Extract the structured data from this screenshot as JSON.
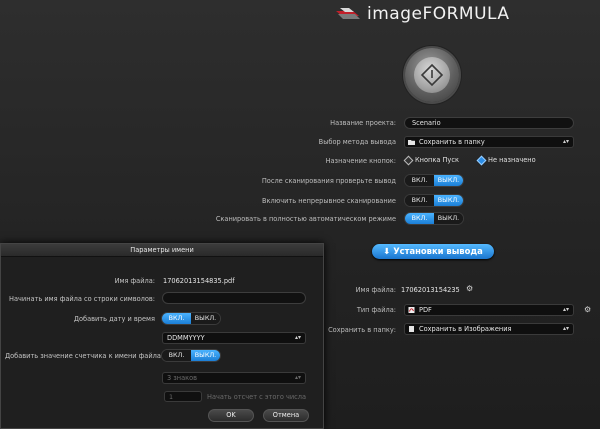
{
  "app": {
    "logo_text": "imageFORMULA"
  },
  "main": {
    "project_name_label": "Название проекта:",
    "project_name_value": "Scenario",
    "output_method_label": "Выбор метода вывода",
    "output_method_value": "Сохранить в папку",
    "button_assign_label": "Назначение кнопок:",
    "button_assign_opt1": "Кнопка Пуск",
    "button_assign_opt2": "Не назначено",
    "check_after_scan_label": "После сканирования проверьте вывод",
    "continuous_scan_label": "Включить непрерывное сканирование",
    "auto_mode_label": "Сканировать в полностью автоматическом режиме",
    "toggle_on": "ВКЛ.",
    "toggle_off": "ВЫКЛ.",
    "output_settings_button": "Установки вывода",
    "filename_label": "Имя файла:",
    "filename_value": "17062013154235",
    "filetype_label": "Тип файла:",
    "filetype_value": "PDF",
    "save_to_label": "Сохранить в папку:",
    "save_to_value": "Сохранить в Изображения"
  },
  "dialog": {
    "title": "Параметры имени",
    "filename_label": "Имя файла:",
    "filename_value": "17062013154835.pdf",
    "prefix_label": "Начинать имя файла со строки символов:",
    "prefix_value": "",
    "add_date_label": "Добавить дату и время",
    "date_format_value": "DDMMYYYY",
    "add_counter_label": "Добавить значение счетчика к имени файла",
    "digits_value": "3 знаков",
    "start_value": "1",
    "start_label": "Начать отсчет с этого числа",
    "toggle_on": "ВКЛ.",
    "toggle_off": "ВЫКЛ.",
    "ok_label": "OK",
    "cancel_label": "Отмена"
  },
  "colors": {
    "accent": "#2b8de6",
    "background": "#262626"
  }
}
